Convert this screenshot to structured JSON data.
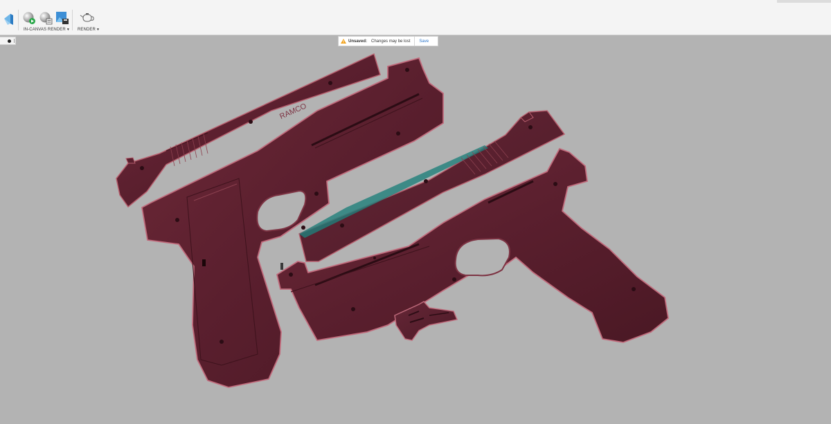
{
  "toolbar": {
    "workspace_icon": "workspace-switcher-icon",
    "groups": [
      {
        "label": "IN-CANVAS RENDER",
        "icons": [
          "in-canvas-render-icon",
          "in-canvas-render-settings-icon",
          "capture-image-icon"
        ]
      },
      {
        "label": "RENDER",
        "icons": [
          "render-teapot-icon"
        ]
      }
    ]
  },
  "notification": {
    "title": "Unsaved:",
    "message": "Changes may be lost",
    "action_label": "Save",
    "icon": "warning-icon"
  },
  "browser_panel": {
    "icon": "browser-toggle-icon"
  },
  "viewport": {
    "background_color": "#b3b3b3",
    "model_color": "#5c2230",
    "model_highlight_color": "#7d3343",
    "model_edge_color": "#c06b7c",
    "accent_color": "#1f7f7a",
    "part_engraving": "RAMCO"
  }
}
